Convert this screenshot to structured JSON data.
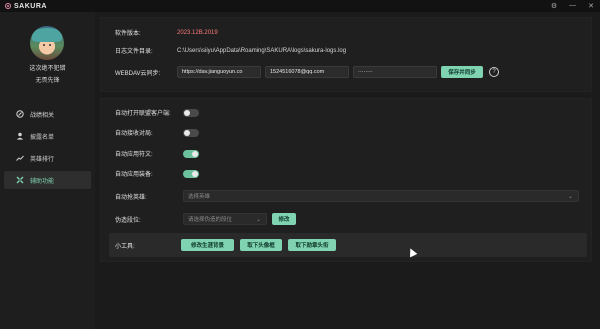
{
  "app": {
    "title": "SAKURA",
    "window_controls": [
      "⚙",
      "—",
      "✕"
    ]
  },
  "sidebar": {
    "username": "这次绝不犯错",
    "rank": "无畏先锋",
    "items": [
      {
        "label": "战绩相关",
        "icon": "swords-icon"
      },
      {
        "label": "披露名单",
        "icon": "person-icon"
      },
      {
        "label": "英雄排行",
        "icon": "trend-icon"
      },
      {
        "label": "辅助功能",
        "icon": "tools-icon",
        "active": true
      }
    ]
  },
  "info": {
    "version_label": "软件版本:",
    "version_value": "2023.12B.2019",
    "logdir_label": "日志文件目录:",
    "logdir_value": "C:\\Users\\siiyu\\AppData\\Roaming\\SAKURA\\logs\\sakura-logs.log",
    "webdav_label": "WEBDAV云同步:",
    "webdav_url": "https://dav.jianguoyun.co",
    "webdav_user": "1524516078@qq.com",
    "webdav_pass": "········",
    "sync_button": "保存并同步",
    "help": "?"
  },
  "settings": {
    "auto_open_client": "自动打开联盟客户端:",
    "auto_accept": "自动接收对局:",
    "auto_runes": "自动应用符文:",
    "auto_equipment": "自动应用装备:",
    "auto_pick_label": "自动抢英雄:",
    "auto_pick_placeholder": "选择英雄",
    "rank_label": "伪造段位:",
    "rank_placeholder": "请选择伪造的段位",
    "rank_button": "修改",
    "tools_label": "小工具:",
    "tool_buttons": [
      "修改生涯背景",
      "取下头像框",
      "取下勋章头衔"
    ]
  },
  "toggles": {
    "auto_open_client": false,
    "auto_accept": false,
    "auto_runes": true,
    "auto_equipment": true
  }
}
